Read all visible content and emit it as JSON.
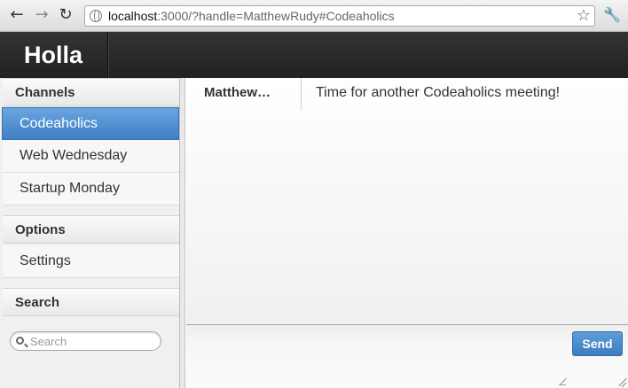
{
  "browser": {
    "url_host": "localhost",
    "url_rest": ":3000/?handle=MatthewRudy#Codeaholics",
    "icons": [
      "back-icon",
      "forward-icon",
      "reload-icon",
      "globe-icon",
      "star-icon",
      "wrench-icon"
    ]
  },
  "app": {
    "title": "Holla"
  },
  "sidebar": {
    "channels_header": "Channels",
    "channels": [
      {
        "label": "Codeaholics",
        "active": true
      },
      {
        "label": "Web Wednesday",
        "active": false
      },
      {
        "label": "Startup Monday",
        "active": false
      }
    ],
    "options_header": "Options",
    "options": [
      {
        "label": "Settings"
      }
    ],
    "search_header": "Search",
    "search_placeholder": "Search"
  },
  "messages": [
    {
      "author": "Matthew…",
      "text": "Time for another Codeaholics meeting!"
    }
  ],
  "composer": {
    "send_label": "Send"
  },
  "colors": {
    "accent": "#4a8ad0",
    "header": "#2a2a2a"
  }
}
